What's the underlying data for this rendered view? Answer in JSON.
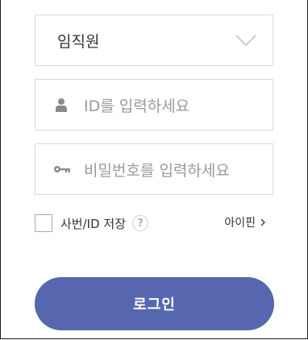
{
  "user_type_select": {
    "selected": "임직원",
    "icon": "chevron-down-icon"
  },
  "id_input": {
    "placeholder": "ID를 입력하세요",
    "value": "",
    "icon": "user-icon"
  },
  "password_input": {
    "placeholder": "비밀번호를 입력하세요",
    "value": "",
    "icon": "key-icon"
  },
  "remember": {
    "label": "사번/ID 저장",
    "checked": false,
    "help_glyph": "?"
  },
  "ipin": {
    "label": "아이핀"
  },
  "login": {
    "label": "로그인"
  },
  "colors": {
    "button": "#5667b0",
    "border": "#d9d9d9",
    "placeholder": "#9a9a9a"
  }
}
